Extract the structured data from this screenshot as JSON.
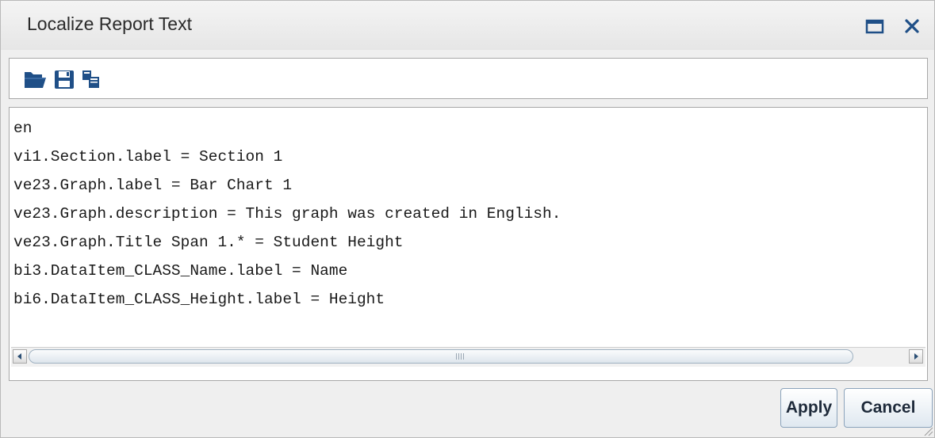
{
  "dialog": {
    "title": "Localize Report Text"
  },
  "toolbar": {
    "icons": [
      "open-folder-icon",
      "save-icon",
      "copy-icon"
    ]
  },
  "editor": {
    "lines": [
      "en",
      "vi1.Section.label = Section 1",
      "ve23.Graph.label = Bar Chart 1",
      "ve23.Graph.description = This graph was created in English.",
      "ve23.Graph.Title Span 1.* = Student Height",
      "bi3.DataItem_CLASS_Name.label = Name",
      "bi6.DataItem_CLASS_Height.label = Height"
    ]
  },
  "buttons": {
    "apply_label": "Apply",
    "cancel_label": "Cancel"
  },
  "colors": {
    "icon_blue": "#1f4f87",
    "button_text": "#1e2a3a",
    "dialog_background": "#efefef"
  }
}
